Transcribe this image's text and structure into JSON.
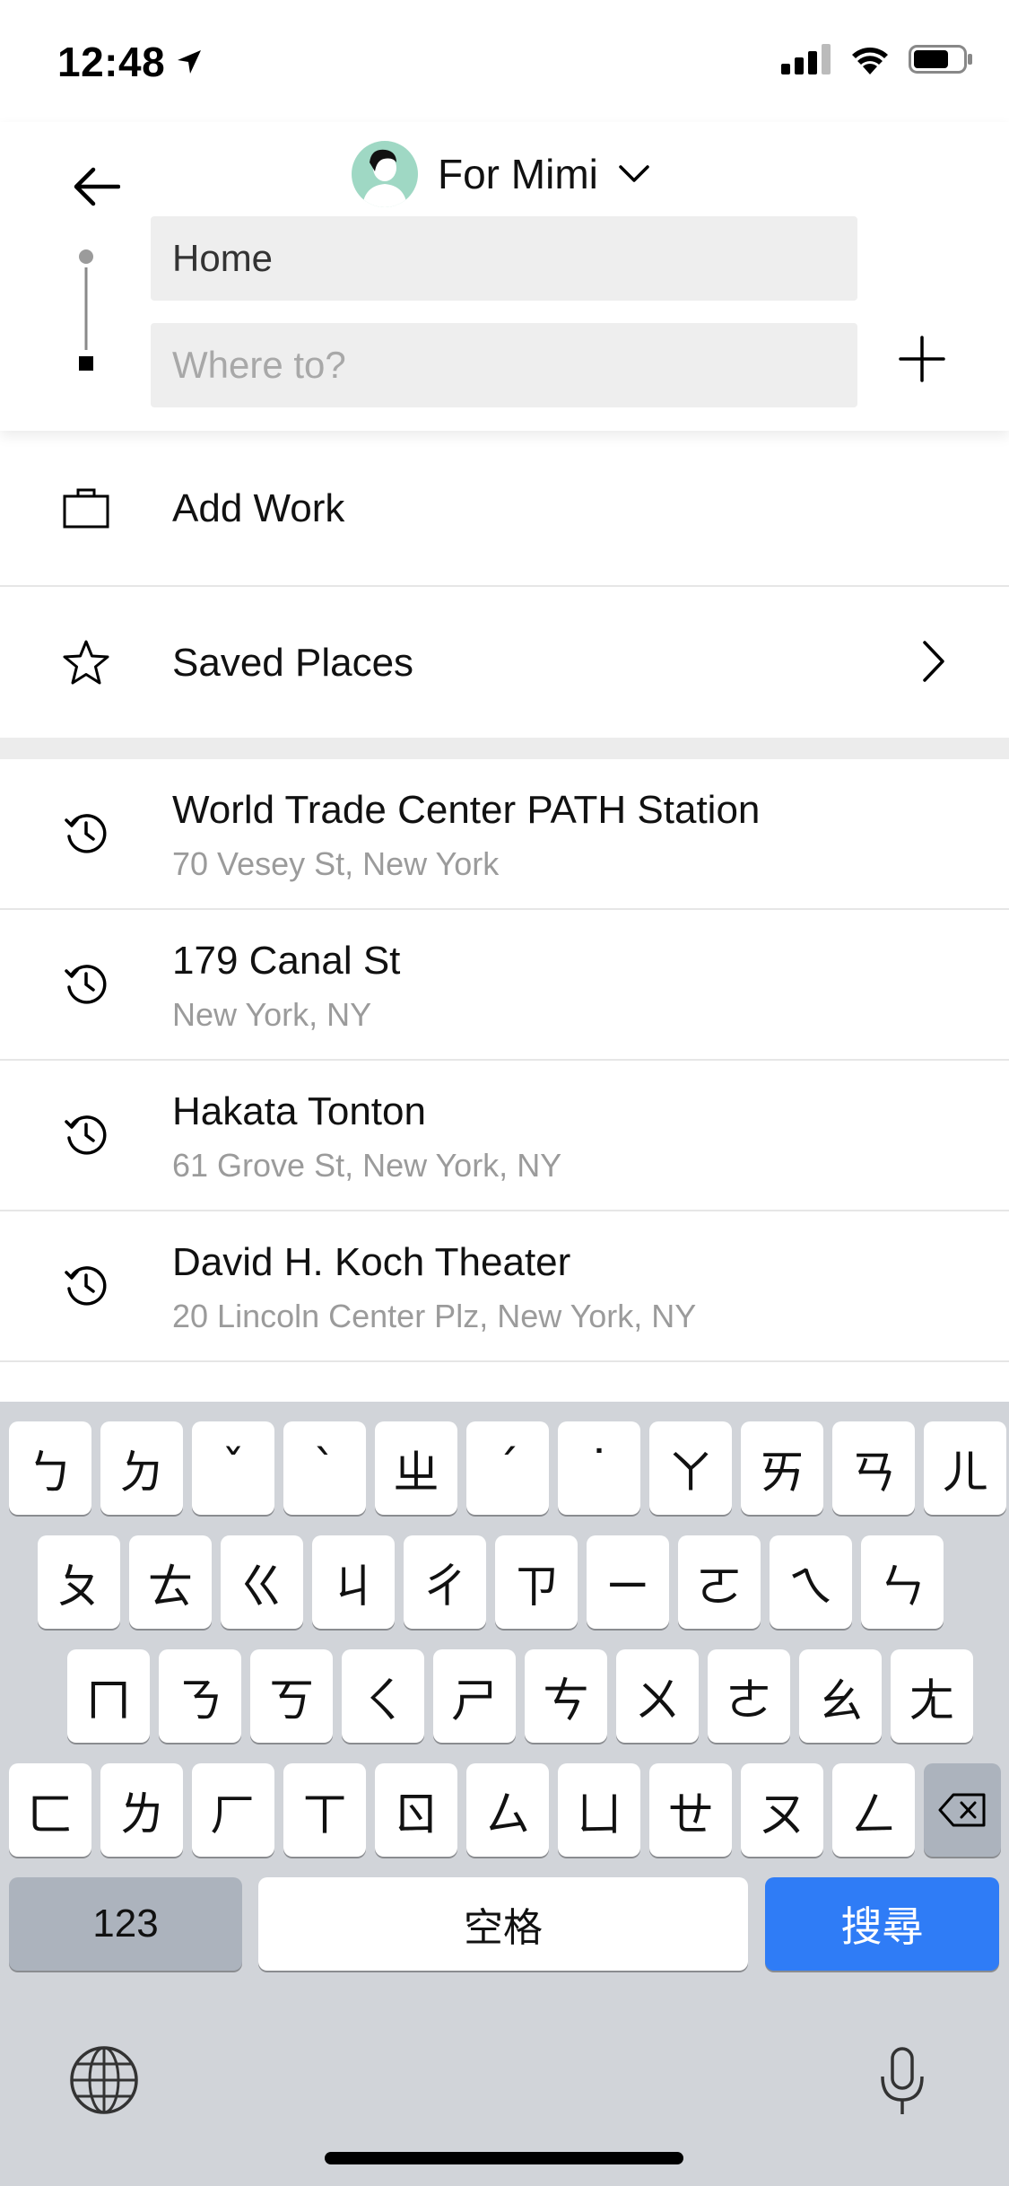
{
  "status_bar": {
    "time": "12:48"
  },
  "header": {
    "rider_label": "For Mimi",
    "pickup_value": "Home",
    "destination_placeholder": "Where to?"
  },
  "shortcuts": [
    {
      "label": "Add Work",
      "icon": "briefcase-icon"
    },
    {
      "label": "Saved Places",
      "icon": "star-icon"
    }
  ],
  "recent": [
    {
      "title": "World Trade Center PATH Station",
      "subtitle": "70 Vesey St, New York",
      "icon": "history-icon"
    },
    {
      "title": "179 Canal St",
      "subtitle": "New York, NY",
      "icon": "history-icon"
    },
    {
      "title": "Hakata Tonton",
      "subtitle": "61 Grove St, New York, NY",
      "icon": "history-icon"
    },
    {
      "title": "David H. Koch Theater",
      "subtitle": "20 Lincoln Center Plz, New York, NY",
      "icon": "history-icon"
    }
  ],
  "keyboard": {
    "row1": [
      "ㄅ",
      "ㄉ",
      "ˇ",
      "ˋ",
      "ㄓ",
      "ˊ",
      "˙",
      "ㄚ",
      "ㄞ",
      "ㄢ",
      "ㄦ"
    ],
    "row2": [
      "ㄆ",
      "ㄊ",
      "ㄍ",
      "ㄐ",
      "ㄔ",
      "ㄗ",
      "ㄧ",
      "ㄛ",
      "ㄟ",
      "ㄣ"
    ],
    "row3": [
      "ㄇ",
      "ㄋ",
      "ㄎ",
      "ㄑ",
      "ㄕ",
      "ㄘ",
      "ㄨ",
      "ㄜ",
      "ㄠ",
      "ㄤ"
    ],
    "row4": [
      "ㄈ",
      "ㄌ",
      "ㄏ",
      "ㄒ",
      "ㄖ",
      "ㄙ",
      "ㄩ",
      "ㄝ",
      "ㄡ",
      "ㄥ"
    ],
    "numbers_label": "123",
    "space_label": "空格",
    "search_label": "搜尋"
  },
  "colors": {
    "search_key": "#2f7cf6",
    "keyboard_bg": "#d1d4d9",
    "avatar_bg": "#9fd8c4"
  }
}
